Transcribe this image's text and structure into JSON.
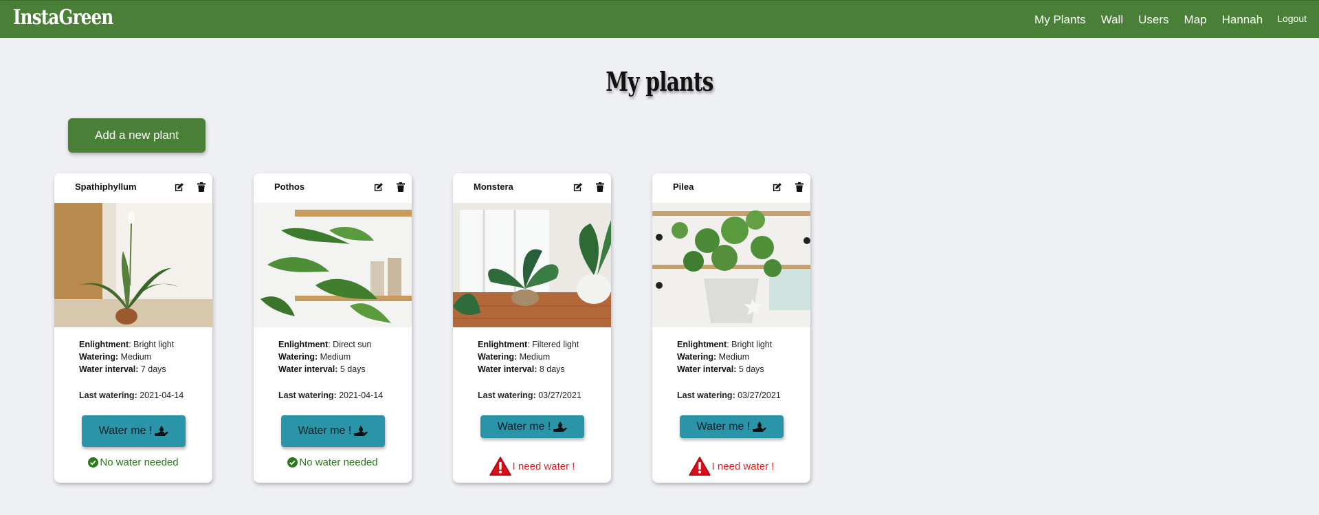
{
  "nav": {
    "brand": "InstaGreen",
    "links": [
      "My Plants",
      "Wall",
      "Users",
      "Map",
      "Hannah",
      "Logout"
    ]
  },
  "page": {
    "title": "My plants",
    "add_button": "Add a new plant"
  },
  "labels": {
    "enlightment": "Enlightment",
    "watering": "Watering:",
    "water_interval": "Water interval:",
    "last_watering": "Last watering:",
    "water_button": "Water me !"
  },
  "plants": [
    {
      "name": "Spathiphyllum",
      "enlightment": ": Bright light",
      "watering": " Medium",
      "interval": " 7 days",
      "last_watering": " 2021-04-14",
      "status": "No water needed",
      "status_type": "ok"
    },
    {
      "name": "Pothos",
      "enlightment": ": Direct sun",
      "watering": " Medium",
      "interval": " 5 days",
      "last_watering": " 2021-04-14",
      "status": "No water needed",
      "status_type": "ok"
    },
    {
      "name": "Monstera",
      "enlightment": ": Filtered light",
      "watering": " Medium",
      "interval": " 8 days",
      "last_watering": " 03/27/2021",
      "status": " I need water !",
      "status_type": "need"
    },
    {
      "name": "Pilea",
      "enlightment": ": Bright light",
      "watering": " Medium",
      "interval": " 5 days",
      "last_watering": " 03/27/2021",
      "status": " I need water !",
      "status_type": "need"
    }
  ],
  "icons": {
    "edit": "edit-icon",
    "trash": "trash-icon",
    "water": "watering-hand-icon",
    "ok": "check-circle-icon",
    "warning": "warning-triangle-icon"
  },
  "colors": {
    "navbar": "#4a7f37",
    "accent_button": "#2a95a8",
    "ok_text": "#2b7a19",
    "warning_text": "#e02020"
  }
}
